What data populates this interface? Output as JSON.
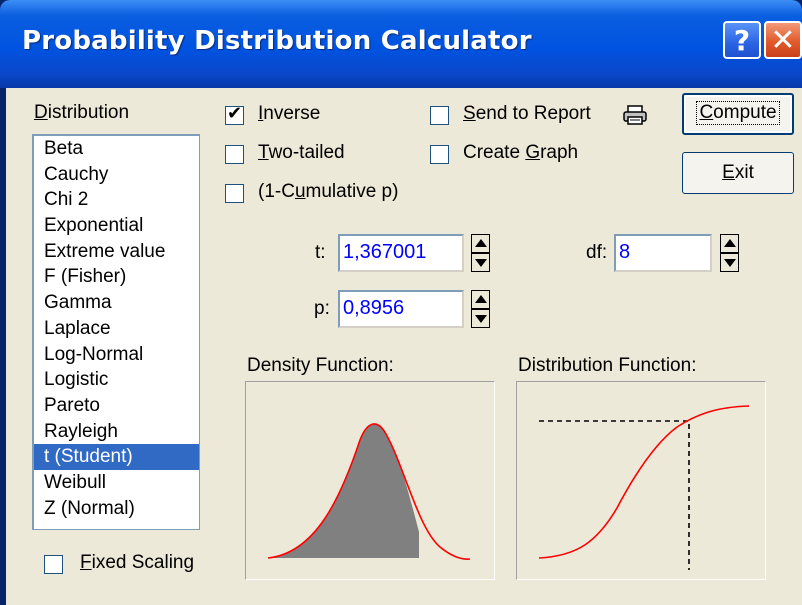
{
  "window": {
    "title": "Probability Distribution Calculator",
    "help_glyph": "?",
    "close_glyph": "✕"
  },
  "distribution": {
    "label": "Distribution",
    "items": [
      "Beta",
      "Cauchy",
      "Chi 2",
      "Exponential",
      "Extreme value",
      "F (Fisher)",
      "Gamma",
      "Laplace",
      "Log-Normal",
      "Logistic",
      "Pareto",
      "Rayleigh",
      "t (Student)",
      "Weibull",
      "Z (Normal)"
    ],
    "selected": "t (Student)"
  },
  "options": {
    "inverse": {
      "label": "Inverse",
      "checked": true
    },
    "two_tailed": {
      "label": "Two-tailed",
      "checked": false
    },
    "one_minus_cumulative": {
      "label": "(1-Cumulative p)",
      "checked": false
    },
    "send_to_report": {
      "label": "Send to Report",
      "checked": false
    },
    "create_graph": {
      "label": "Create Graph",
      "checked": false
    },
    "fixed_scaling": {
      "label": "Fixed Scaling",
      "checked": false
    }
  },
  "buttons": {
    "compute": "Compute",
    "exit": "Exit"
  },
  "params": {
    "t": {
      "label": "t:",
      "value": "1,367001"
    },
    "df": {
      "label": "df:",
      "value": "8"
    },
    "p": {
      "label": "p:",
      "value": "0,8956"
    }
  },
  "graphs": {
    "density_label": "Density Function:",
    "distribution_label": "Distribution Function:"
  },
  "icons": {
    "printer": "printer-icon"
  },
  "colors": {
    "title_bar": "#0053e1",
    "selection": "#316ac5",
    "field_text": "#0000ff",
    "curve": "#ff0000",
    "shaded_area": "#808080",
    "dialog_bg": "#ece9d8"
  }
}
